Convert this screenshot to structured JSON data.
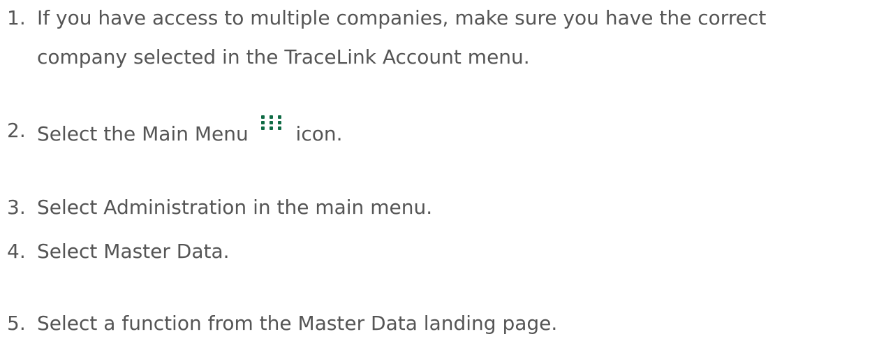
{
  "steps": [
    {
      "number": "1.",
      "lines": [
        "If you have access to multiple companies, make sure you have the correct",
        "company selected in the TraceLink Account menu."
      ]
    },
    {
      "number": "2.",
      "text_before": "Select the Main Menu",
      "icon": "main-menu-grid-icon",
      "text_after": "icon."
    },
    {
      "number": "3.",
      "text": "Select Administration in the main menu."
    },
    {
      "number": "4.",
      "text": "Select Master Data."
    },
    {
      "number": "5.",
      "text": "Select a function from the Master Data landing page."
    }
  ],
  "colors": {
    "text": "#555555",
    "icon": "#0f6b44",
    "background": "#ffffff"
  }
}
